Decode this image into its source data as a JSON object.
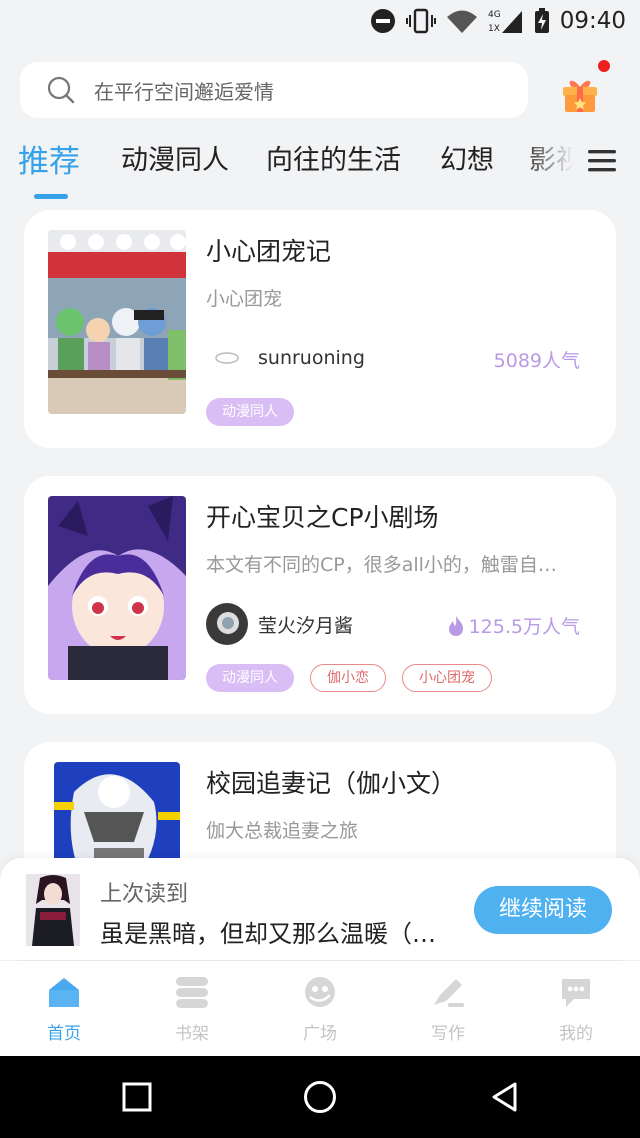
{
  "status": {
    "time": "09:40",
    "network": "4G",
    "signal_sub": "1X"
  },
  "search": {
    "placeholder": "在平行空间邂逅爱情"
  },
  "tabs": [
    {
      "label": "推荐"
    },
    {
      "label": "动漫同人"
    },
    {
      "label": "向往的生活"
    },
    {
      "label": "幻想"
    },
    {
      "label": "影视"
    }
  ],
  "cards": [
    {
      "title": "小心团宠记",
      "subtitle": "小心团宠",
      "author": "sunruoning",
      "popularity": "5089人气",
      "tags": [
        "动漫同人"
      ]
    },
    {
      "title": "开心宝贝之CP小剧场",
      "subtitle": "本文有不同的CP，很多all小的，触雷自…",
      "author": "莹火汐月酱",
      "popularity": "125.5万人气",
      "tags": [
        "动漫同人",
        "伽小恋",
        "小心团宠"
      ]
    },
    {
      "title": "校园追妻记（伽小文）",
      "subtitle": "伽大总裁追妻之旅"
    }
  ],
  "last_read": {
    "label": "上次读到",
    "title": "虽是黑暗，但却又那么温暖（…",
    "button": "继续阅读"
  },
  "bottom_nav": [
    {
      "label": "首页",
      "icon": "home-icon"
    },
    {
      "label": "书架",
      "icon": "bookshelf-icon"
    },
    {
      "label": "广场",
      "icon": "plaza-icon"
    },
    {
      "label": "写作",
      "icon": "write-icon"
    },
    {
      "label": "我的",
      "icon": "profile-icon"
    }
  ],
  "colors": {
    "accent": "#36a2ea",
    "tag_fill": "#d9bdf5",
    "tag_outline": "#e98a8a",
    "popularity": "#b99ae6",
    "button": "#4fb1f0"
  }
}
